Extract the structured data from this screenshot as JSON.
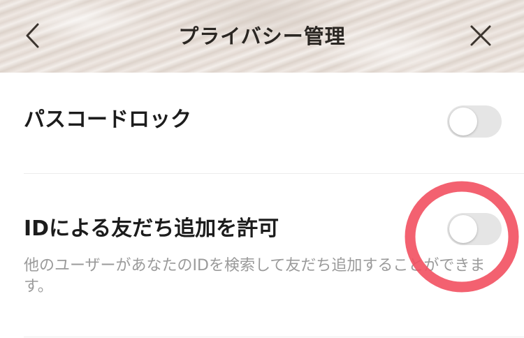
{
  "header": {
    "title": "プライバシー管理",
    "back_icon": "chevron-left-icon",
    "close_icon": "close-icon"
  },
  "settings": [
    {
      "label": "パスコードロック",
      "enabled": false
    },
    {
      "label": "IDによる友だち追加を許可",
      "enabled": false,
      "description": "他のユーザーがあなたのIDを検索して友だち追加することができます。"
    }
  ],
  "colors": {
    "toggle_off": "#e5e5e5",
    "annotation_circle": "#f25060",
    "description_text": "#9a9a9a"
  }
}
